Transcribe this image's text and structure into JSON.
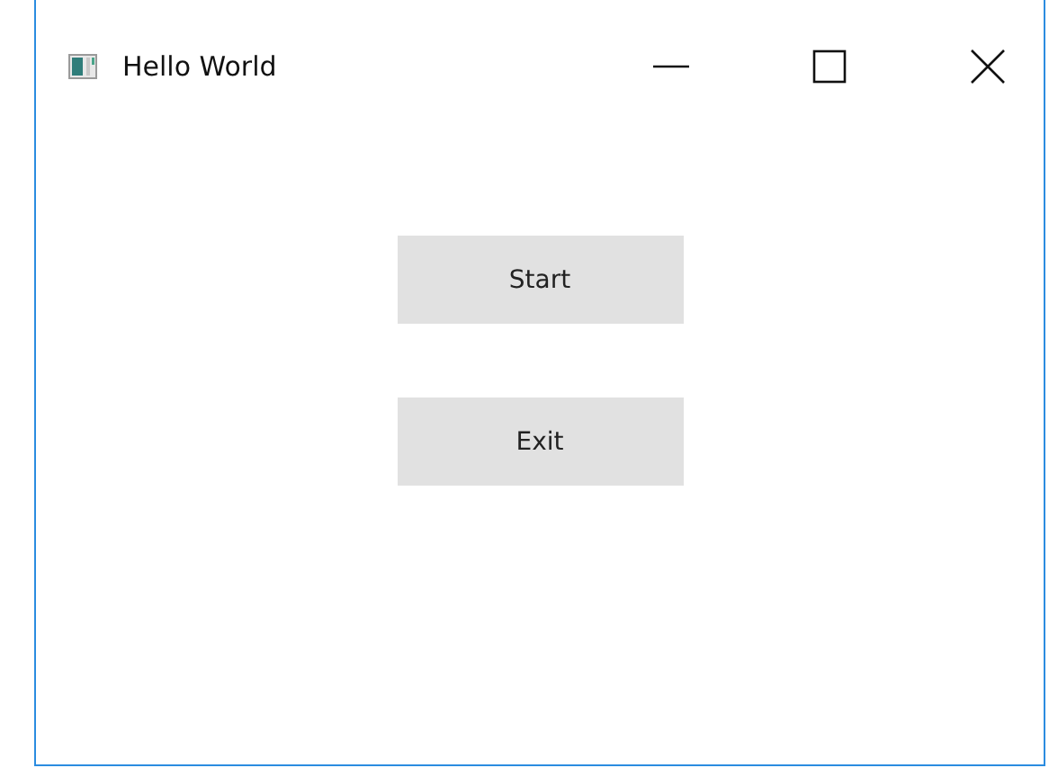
{
  "window": {
    "title": "Hello World"
  },
  "buttons": [
    {
      "label": "Start"
    },
    {
      "label": "Exit"
    }
  ]
}
